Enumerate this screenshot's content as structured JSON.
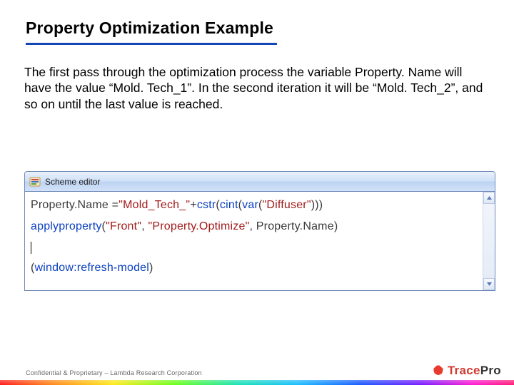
{
  "title": "Property Optimization Example",
  "body": "The first pass through the optimization process the variable Property. Name will have the value “Mold. Tech_1”. In the second iteration it will be “Mold. Tech_2”, and so on until the last value is reached.",
  "editor": {
    "window_title": "Scheme editor",
    "code": {
      "line1": {
        "varname": "Property.Name",
        "assign": " =",
        "str1": "\"Mold_Tech_\"",
        "plus": "+",
        "fn1": "cstr",
        "paren1": "(",
        "fn2": "cint",
        "paren2": "(",
        "fn3": "var",
        "paren3": "(",
        "str2": "\"Diffuser\"",
        "close": ")))"
      },
      "line2": {
        "fn": "applyproperty",
        "paren": "(",
        "arg1": "\"Front\"",
        "comma1": ", ",
        "arg2": "\"Property.Optimize\"",
        "comma2": ", ",
        "arg3": "Property.Name",
        "close": ")"
      },
      "line3": {
        "open": "(",
        "sym": "window:refresh-model",
        "close": ")"
      }
    }
  },
  "footer": {
    "confidential": "Confidential & Proprietary – Lambda Research Corporation",
    "logo_trace": "Trace",
    "logo_pro": "Pro"
  }
}
